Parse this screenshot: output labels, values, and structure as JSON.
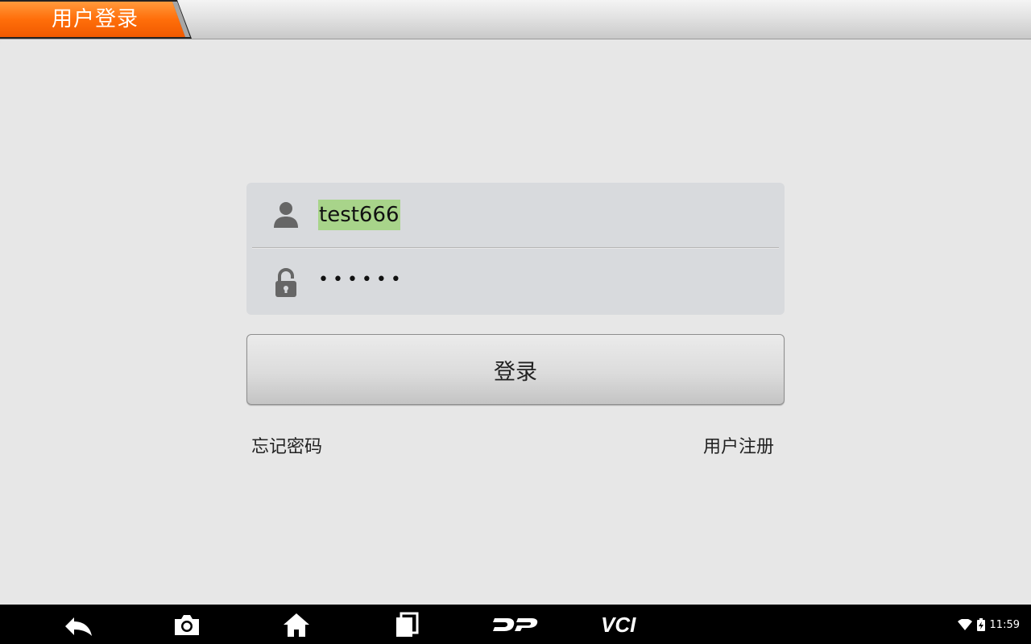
{
  "header": {
    "title": "用户登录",
    "accent_color": "#ff6a00"
  },
  "login_form": {
    "username_value": "test666",
    "password_mask": "••••••",
    "login_button_label": "登录",
    "forgot_password_label": "忘记密码",
    "register_label": "用户注册"
  },
  "navbar": {
    "buttons": [
      {
        "icon": "back-icon"
      },
      {
        "icon": "camera-icon"
      },
      {
        "icon": "home-icon"
      },
      {
        "icon": "recent-apps-icon"
      },
      {
        "icon": "dp-logo-icon",
        "text": "DP"
      },
      {
        "icon": "vci-icon",
        "text": "VCI"
      }
    ],
    "status": {
      "time": "11:59",
      "icons": [
        "wifi-icon",
        "battery-charging-icon"
      ]
    }
  }
}
